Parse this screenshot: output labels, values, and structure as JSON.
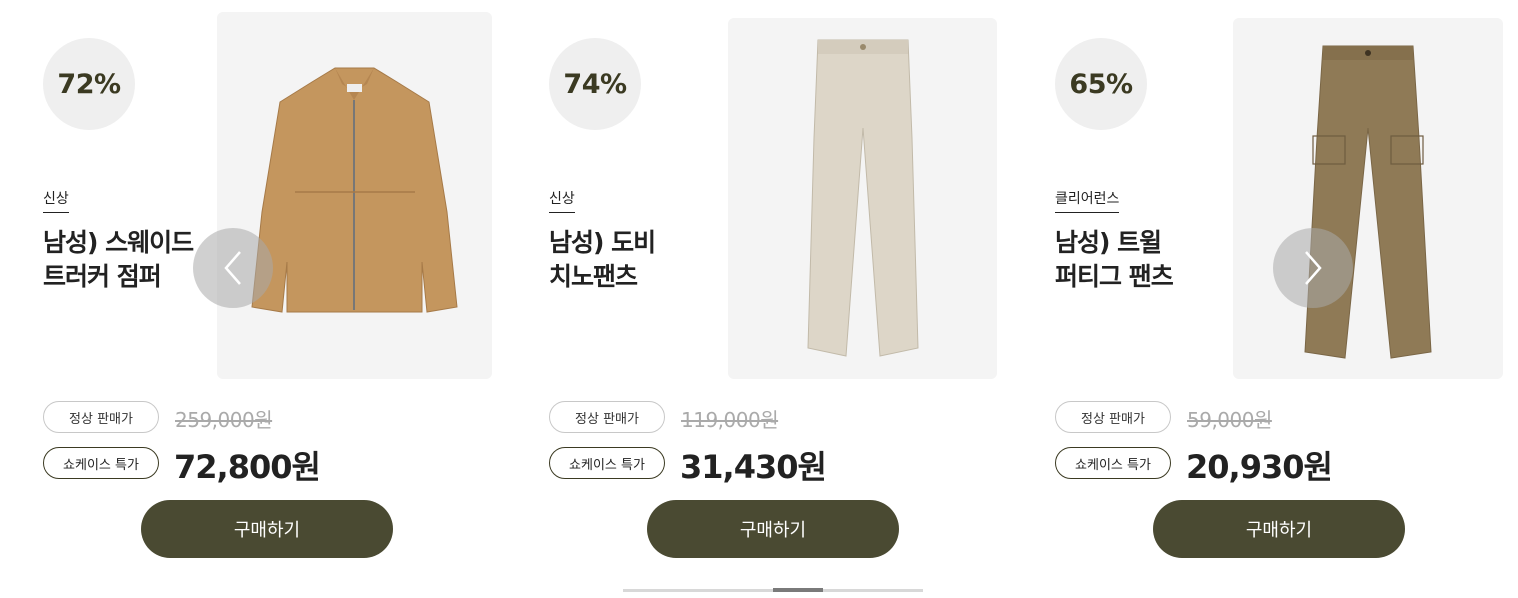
{
  "products": [
    {
      "discount": "72%",
      "tag": "신상",
      "name_line1": "남성) 스웨이드",
      "name_line2": "트러커 점퍼",
      "regular_label": "정상 판매가",
      "regular_price": "259,000원",
      "special_label": "쇼케이스 특가",
      "sale_price": "72,800원",
      "buy_label": "구매하기",
      "image_color": "#c4965e"
    },
    {
      "discount": "74%",
      "tag": "신상",
      "name_line1": "남성) 도비",
      "name_line2": "치노팬츠",
      "regular_label": "정상 판매가",
      "regular_price": "119,000원",
      "special_label": "쇼케이스 특가",
      "sale_price": "31,430원",
      "buy_label": "구매하기",
      "image_color": "#ddd6c8"
    },
    {
      "discount": "65%",
      "tag": "클리어런스",
      "name_line1": "남성) 트윌",
      "name_line2": "퍼티그 팬츠",
      "regular_label": "정상 판매가",
      "regular_price": "59,000원",
      "special_label": "쇼케이스 특가",
      "sale_price": "20,930원",
      "buy_label": "구매하기",
      "image_color": "#8f7a56"
    }
  ],
  "carousel": {
    "prev_icon": "chevron-left-icon",
    "next_icon": "chevron-right-icon"
  },
  "colors": {
    "accent": "#4a4a32",
    "discount_text": "#3b3a22",
    "image_bg": "#f4f4f4"
  }
}
